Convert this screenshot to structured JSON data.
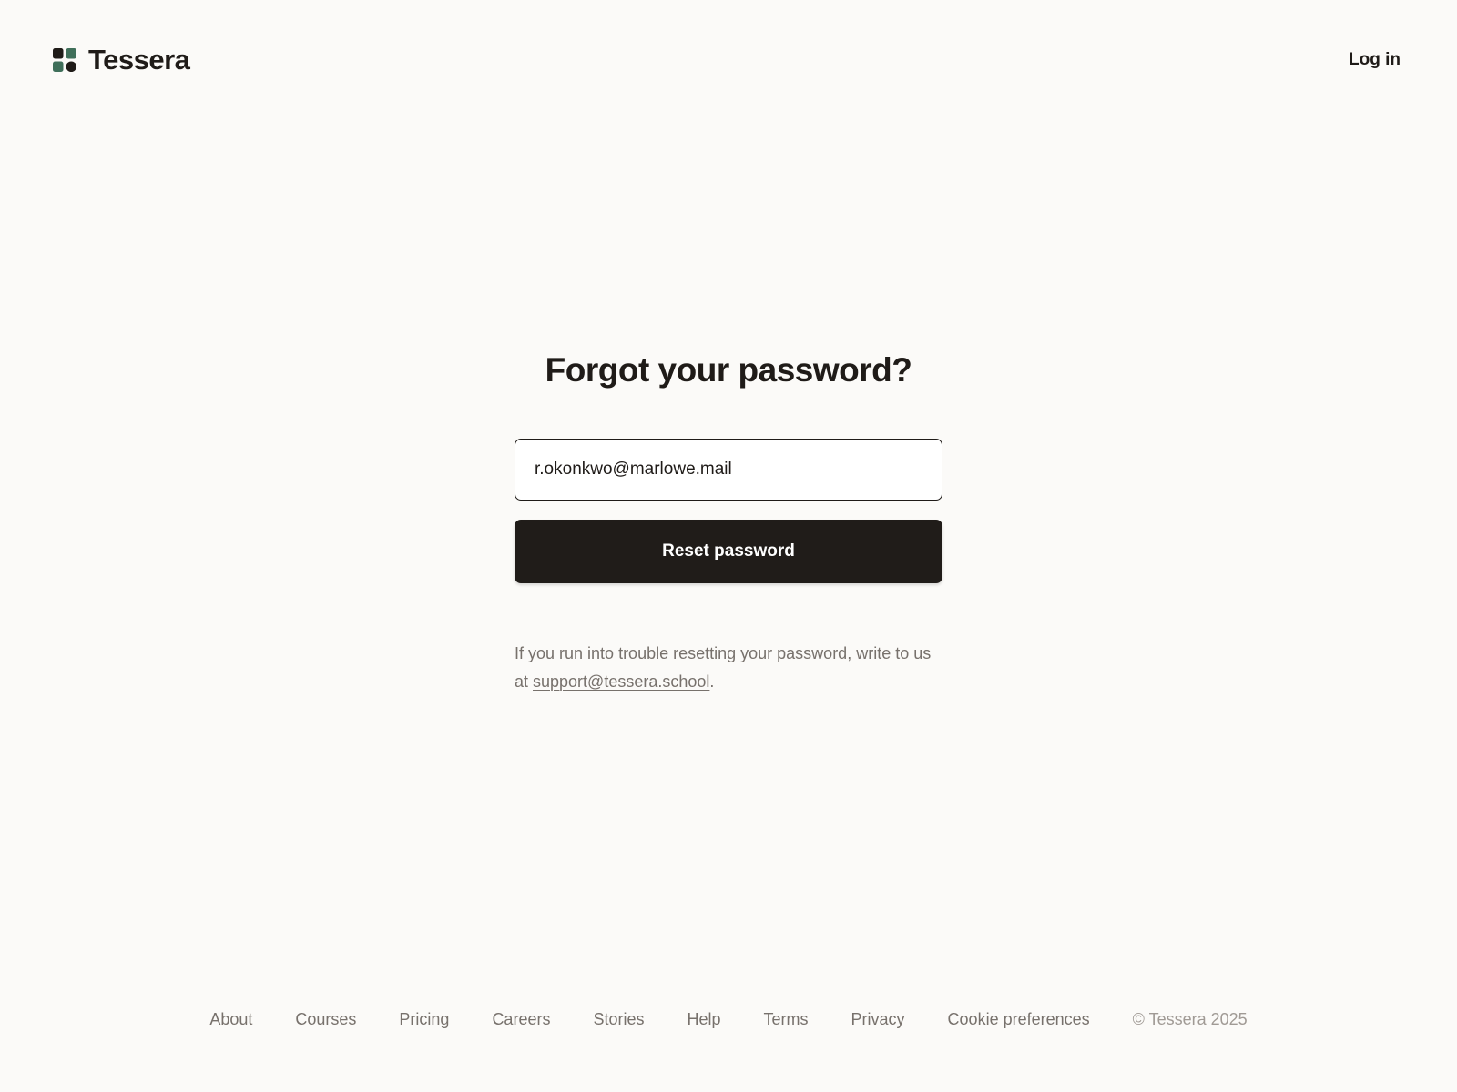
{
  "brand": {
    "name": "Tessera",
    "mark_colors": {
      "top_left": "#1f1b18",
      "top_right": "#3f6f5a",
      "bottom_left": "#3f6f5a",
      "bottom_right": "#1f1b18"
    }
  },
  "header": {
    "login_label": "Log in"
  },
  "form": {
    "title": "Forgot your password?",
    "email_value": "r.okonkwo@marlowe.mail",
    "submit_label": "Reset password"
  },
  "help": {
    "text_before": "If you run into trouble resetting your password, write to us at ",
    "email": "support@tessera.school",
    "text_after": "."
  },
  "footer": {
    "links": [
      "About",
      "Courses",
      "Pricing",
      "Careers",
      "Stories",
      "Help",
      "Terms",
      "Privacy",
      "Cookie preferences"
    ],
    "copyright": "© Tessera 2025"
  },
  "colors": {
    "background": "#fbfaf8",
    "text": "#1f1b18",
    "muted": "#77716c",
    "accent": "#3f6f5a",
    "button": "#201c19"
  }
}
